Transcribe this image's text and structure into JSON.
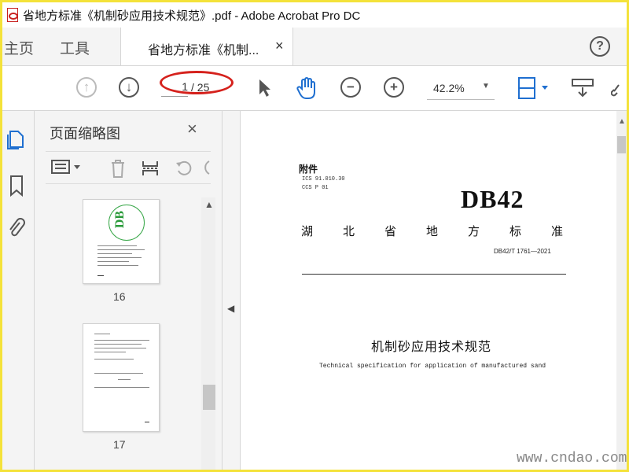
{
  "window": {
    "title": "省地方标准《机制砂应用技术规范》.pdf - Adobe Acrobat Pro DC"
  },
  "tabs": {
    "home": "主页",
    "tools": "工具",
    "document": "省地方标准《机制...",
    "close_symbol": "×",
    "help_symbol": "?"
  },
  "toolbar": {
    "page_current": "1",
    "page_total": "/ 25",
    "zoom": "42.2%",
    "icons": [
      "prev-page-icon",
      "next-page-icon",
      "select-cursor-icon",
      "hand-tool-icon",
      "zoom-out-icon",
      "zoom-in-icon",
      "fit-page-icon",
      "scroll-mode-icon",
      "link-icon"
    ]
  },
  "rail": {
    "icons": [
      "page-thumbnails-icon",
      "bookmarks-icon",
      "attachments-icon"
    ]
  },
  "thumbnails_panel": {
    "title": "页面缩略图",
    "close_symbol": "×",
    "pages": [
      {
        "number": "16"
      },
      {
        "number": "17"
      }
    ]
  },
  "document": {
    "annex": "附件",
    "ics": "ICS  91.010.30",
    "ccs": "CCS  P  01",
    "code": "DB42",
    "standard_level": "湖北省地方标准",
    "standard_number": "DB42/T 1761—2021",
    "title_cn": "机制砂应用技术规范",
    "title_en": "Technical specification for application of manufactured sand"
  },
  "watermark": "www.cndao.com",
  "colors": {
    "highlight_border": "#f4e23a",
    "annotation_red": "#d5211c",
    "active_blue": "#1f6fd0",
    "stamp_green": "#2a9a3a"
  }
}
